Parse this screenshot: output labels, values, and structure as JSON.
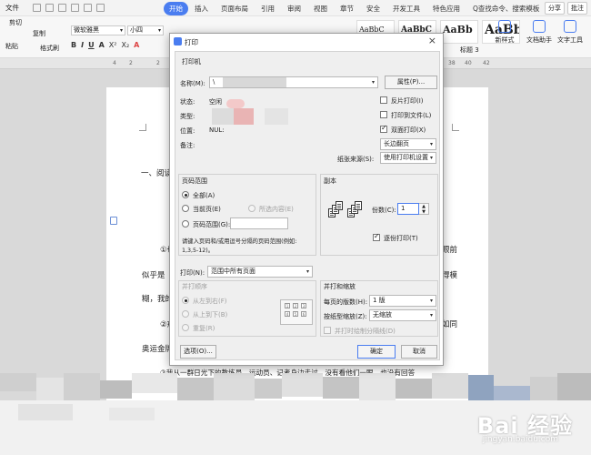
{
  "menubar": {
    "file_label": "文件",
    "tabs": [
      "开始",
      "插入",
      "页面布局",
      "引用",
      "审阅",
      "视图",
      "章节",
      "安全",
      "开发工具",
      "特色应用",
      "Q查找命令、搜索模板"
    ],
    "share_label": "分享",
    "comment_label": "批注"
  },
  "ribbon": {
    "cut_label": "剪切",
    "paste_label": "粘贴",
    "copy_label": "复制",
    "format_painter_label": "格式刷",
    "font_name": "微软雅黑",
    "font_size": "小四",
    "format_buttons": [
      "B",
      "I",
      "U",
      "A",
      "X²",
      "X₂",
      "A"
    ],
    "styles": [
      "AaBbC",
      "AaBbC",
      "AaBb",
      "AaBbC"
    ],
    "style_label_heading3": "标题 3",
    "new_style_label": "新样式",
    "doc_assistant_label": "文档助手",
    "text_tools_label": "文字工具"
  },
  "ruler": {
    "ticks": [
      "4",
      "2",
      "2",
      "4",
      "6",
      "8",
      "38",
      "40",
      "42"
    ]
  },
  "document": {
    "heading_fragment": "一、阅读",
    "line1_num": "①也",
    "line1_end": "眼前",
    "line2_start": "似乎是",
    "line2_end": "得模",
    "line3_start": "糊，我的",
    "line4_num": "②戒",
    "line4_end": "如同",
    "line5_start": "奥运金牌",
    "line6": "③我从一群日光下的教练员、运动员、记者身边走过，没有看他们一眼，也没有回答"
  },
  "dialog": {
    "title": "打印",
    "close_glyph": "×",
    "printer_section": "打印机",
    "name_label": "名称(M):",
    "name_value": "\\",
    "properties_button": "属性(P)...",
    "status_label": "状态:",
    "status_value": "空闲",
    "type_label": "类型:",
    "location_label": "位置:",
    "location_value": "NUL:",
    "comment_label": "备注:",
    "reverse_print_label": "反片打印(I)",
    "print_to_file_label": "打印到文件(L)",
    "duplex_label": "双面打印(X)",
    "duplex_option": "长边翻页",
    "paper_source_label": "纸张来源(S):",
    "paper_source_value": "使用打印机设置",
    "page_range_section": "页码范围",
    "all_label": "全部(A)",
    "current_page_label": "当前页(E)",
    "selection_label": "所选内容(E)",
    "page_range_label": "页码范围(G):",
    "page_range_hint_1": "请键入页码和/或用逗号分隔的页码范围(例如:",
    "page_range_hint_2": "1,3,5-12)。",
    "copies_section": "副本",
    "copies_label": "份数(C):",
    "copies_value": "1",
    "collate_label": "逐份打印(T)",
    "print_label": "打印(N):",
    "print_value": "范围中所有页面",
    "print_order_section": "并打顺序",
    "order_lr_label": "从左到右(F)",
    "order_tb_label": "从上到下(B)",
    "order_repeat_label": "重复(R)",
    "zoom_section": "并打和缩放",
    "pages_per_sheet_label": "每页的版数(H):",
    "pages_per_sheet_value": "1 版",
    "scale_label": "按纸型缩放(Z):",
    "scale_value": "无缩放",
    "draw_border_label": "并打时绘制分隔线(D)",
    "options_button": "选项(O)...",
    "ok_button": "确定",
    "cancel_button": "取消"
  },
  "watermark": {
    "brand": "Bai 经验",
    "url": "jingyan.baidu.com"
  },
  "colors": {
    "accent": "#4a7df0",
    "dialog_bg": "#efefef"
  }
}
